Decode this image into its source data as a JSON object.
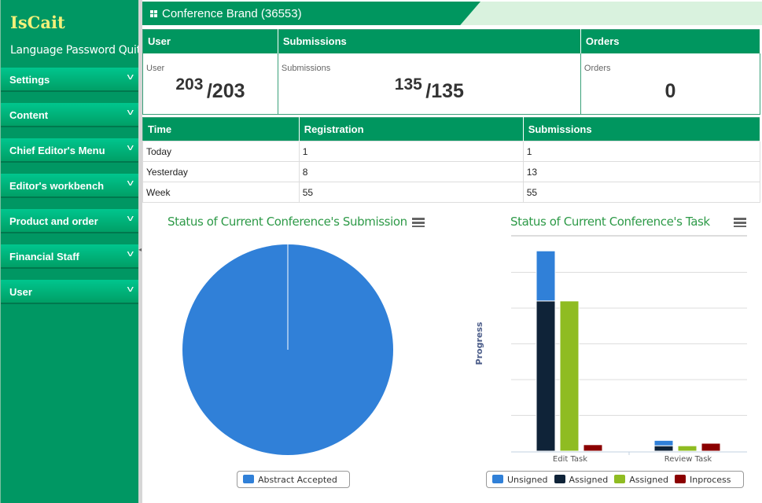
{
  "app": {
    "logo": "IsCait",
    "links": [
      "Language",
      "Password",
      "Quit"
    ]
  },
  "sidebar": {
    "items": [
      {
        "label": "Settings"
      },
      {
        "label": "Content"
      },
      {
        "label": "Chief Editor's Menu"
      },
      {
        "label": "Editor's workbench"
      },
      {
        "label": "Product and order"
      },
      {
        "label": "Financial Staff"
      },
      {
        "label": "User"
      }
    ]
  },
  "header": {
    "title": "Conference Brand (36553)"
  },
  "stats": [
    {
      "header": "User",
      "label": "User",
      "value": "203",
      "total": "/203"
    },
    {
      "header": "Submissions",
      "label": "Submissions",
      "value": "135",
      "total": "/135"
    },
    {
      "header": "Orders",
      "label": "Orders",
      "value": "",
      "total": "0"
    }
  ],
  "time_table": {
    "columns": [
      "Time",
      "Registration",
      "Submissions"
    ],
    "rows": [
      [
        "Today",
        "1",
        "1"
      ],
      [
        "Yesterday",
        "8",
        "13"
      ],
      [
        "Week",
        "55",
        "55"
      ]
    ]
  },
  "colors": {
    "brand": "#00965f",
    "title": "#2e9a48"
  },
  "chart_data": [
    {
      "type": "pie",
      "title": "Status of Current Conference's Submission",
      "slices": [
        {
          "name": "Abstract Accepted",
          "value": 100,
          "color": "#3080d8"
        }
      ],
      "legend": "bottom"
    },
    {
      "type": "bar",
      "stacked": "partial",
      "title": "Status of Current Conference's Task",
      "ylabel": "Progress",
      "categories": [
        "Edit Task",
        "Review Task"
      ],
      "ylim": [
        0,
        6
      ],
      "grid": true,
      "legend": "bottom",
      "series": [
        {
          "name": "Unsigned",
          "color": "#3080d8",
          "stack": "a",
          "values": [
            1.4,
            0.15
          ]
        },
        {
          "name": "Assigned",
          "color": "#0f2338",
          "stack": "a",
          "values": [
            4.2,
            0.15
          ]
        },
        {
          "name": "Assigned",
          "color": "#8fbc22",
          "stack": "b",
          "values": [
            4.2,
            0.15
          ]
        },
        {
          "name": "Inprocess",
          "color": "#8b0000",
          "stack": "c",
          "values": [
            0.18,
            0.22
          ]
        }
      ]
    }
  ]
}
